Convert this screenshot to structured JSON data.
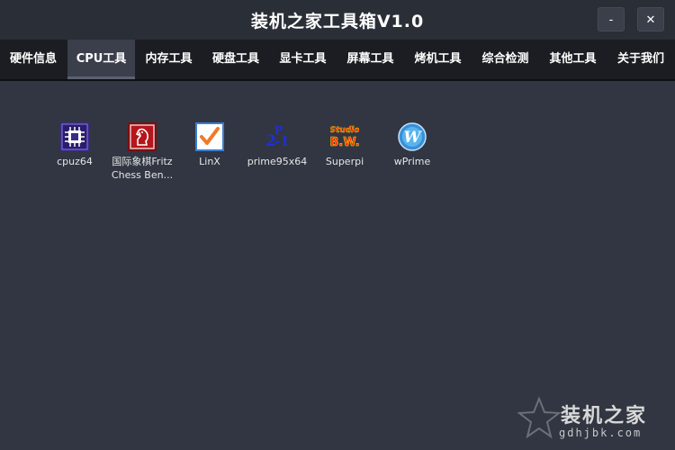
{
  "window": {
    "title": "装机之家工具箱V1.0",
    "minimize_label": "-",
    "close_label": "✕"
  },
  "tabs": [
    {
      "label": "硬件信息",
      "active": false
    },
    {
      "label": "CPU工具",
      "active": true
    },
    {
      "label": "内存工具",
      "active": false
    },
    {
      "label": "硬盘工具",
      "active": false
    },
    {
      "label": "显卡工具",
      "active": false
    },
    {
      "label": "屏幕工具",
      "active": false
    },
    {
      "label": "烤机工具",
      "active": false
    },
    {
      "label": "综合检测",
      "active": false
    },
    {
      "label": "其他工具",
      "active": false
    },
    {
      "label": "关于我们",
      "active": false
    }
  ],
  "tools": [
    {
      "label": "cpuz64",
      "icon": "cpu-chip-icon"
    },
    {
      "label": "国际象棋Fritz Chess Ben...",
      "icon": "chess-knight-icon"
    },
    {
      "label": "LinX",
      "icon": "checkbox-icon"
    },
    {
      "label": "prime95x64",
      "icon": "formula-icon",
      "icon_text": "2P-1"
    },
    {
      "label": "Superpi",
      "icon": "studio-bw-icon",
      "icon_text_top": "Studio",
      "icon_text_bottom": "B.W."
    },
    {
      "label": "wPrime",
      "icon": "w-circle-icon",
      "icon_text": "W"
    }
  ],
  "watermark": {
    "title": "装机之家",
    "url": "gdhjbk.com"
  },
  "colors": {
    "titlebar": "#2a2e36",
    "tabbar": "#1b1d22",
    "content": "#313642",
    "active_tab": "#3a3f4b"
  }
}
